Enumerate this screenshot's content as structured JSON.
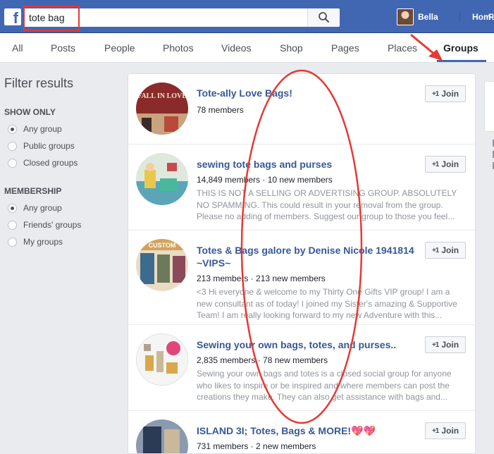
{
  "header": {
    "logo": "f",
    "search": {
      "value": "tote bag",
      "placeholder": ""
    },
    "user_name": "Bella",
    "nav": [
      "Home",
      "F"
    ]
  },
  "tabs": [
    {
      "label": "All",
      "active": false
    },
    {
      "label": "Posts",
      "active": false
    },
    {
      "label": "People",
      "active": false
    },
    {
      "label": "Photos",
      "active": false
    },
    {
      "label": "Videos",
      "active": false
    },
    {
      "label": "Shop",
      "active": false
    },
    {
      "label": "Pages",
      "active": false
    },
    {
      "label": "Places",
      "active": false
    },
    {
      "label": "Groups",
      "active": true
    }
  ],
  "filters": {
    "title": "Filter results",
    "show_only": {
      "heading": "SHOW ONLY",
      "options": [
        {
          "label": "Any group",
          "checked": true
        },
        {
          "label": "Public groups",
          "checked": false
        },
        {
          "label": "Closed groups",
          "checked": false
        }
      ]
    },
    "membership": {
      "heading": "MEMBERSHIP",
      "options": [
        {
          "label": "Any group",
          "checked": true
        },
        {
          "label": "Friends' groups",
          "checked": false
        },
        {
          "label": "My groups",
          "checked": false
        }
      ]
    }
  },
  "results": [
    {
      "name": "Tote-ally Love Bags!",
      "meta": "78 members",
      "description": "",
      "join_label": "Join",
      "thumb_text": "FALL IN LOVE",
      "thumb_colors": [
        "#8b2a2a",
        "#c9a27e"
      ]
    },
    {
      "name": "sewing tote bags and purses",
      "meta": "14,849 members · 10 new members",
      "description": "THIS IS NOT A SELLING OR ADVERTISING GROUP. ABSOLUTELY NO SPAMMING. This could result in your removal from the group. Please no adding of members. Suggest our group to those you feel...",
      "join_label": "Join",
      "thumb_text": "",
      "thumb_colors": [
        "#5aa6b8",
        "#e8c84a"
      ]
    },
    {
      "name": "Totes & Bags galore by Denise Nicole 1941814 ~VIPS~",
      "meta": "213 members · 213 new members",
      "description": "<3 Hi everyone & welcome to my Thirty One Gifts VIP group! I am a new consultant as of today! I joined my Sister's amazing & Supportive Team! I am really looking forward to my new Adventure with this...",
      "join_label": "Join",
      "thumb_text": "CUSTOM",
      "thumb_colors": [
        "#3d6b8f",
        "#d4a35a"
      ]
    },
    {
      "name": "Sewing your own bags, totes, and purses..",
      "meta": "2,835 members · 78 new members",
      "description": "Sewing your own bags and totes is a closed social group for anyone who likes to inspire or be inspired and where members can post the creations they make. They can also get assistance with bags and...",
      "join_label": "Join",
      "thumb_text": "",
      "thumb_colors": [
        "#f5f5f5",
        "#e0467a"
      ]
    },
    {
      "name": "ISLAND 3I; Totes, Bags & MORE!💖💖",
      "meta": "731 members · 2 new members",
      "description": "",
      "join_label": "Join",
      "thumb_text": "",
      "thumb_colors": [
        "#2b3a55",
        "#8a9bb0"
      ]
    }
  ],
  "annotation_color": "#e53935"
}
